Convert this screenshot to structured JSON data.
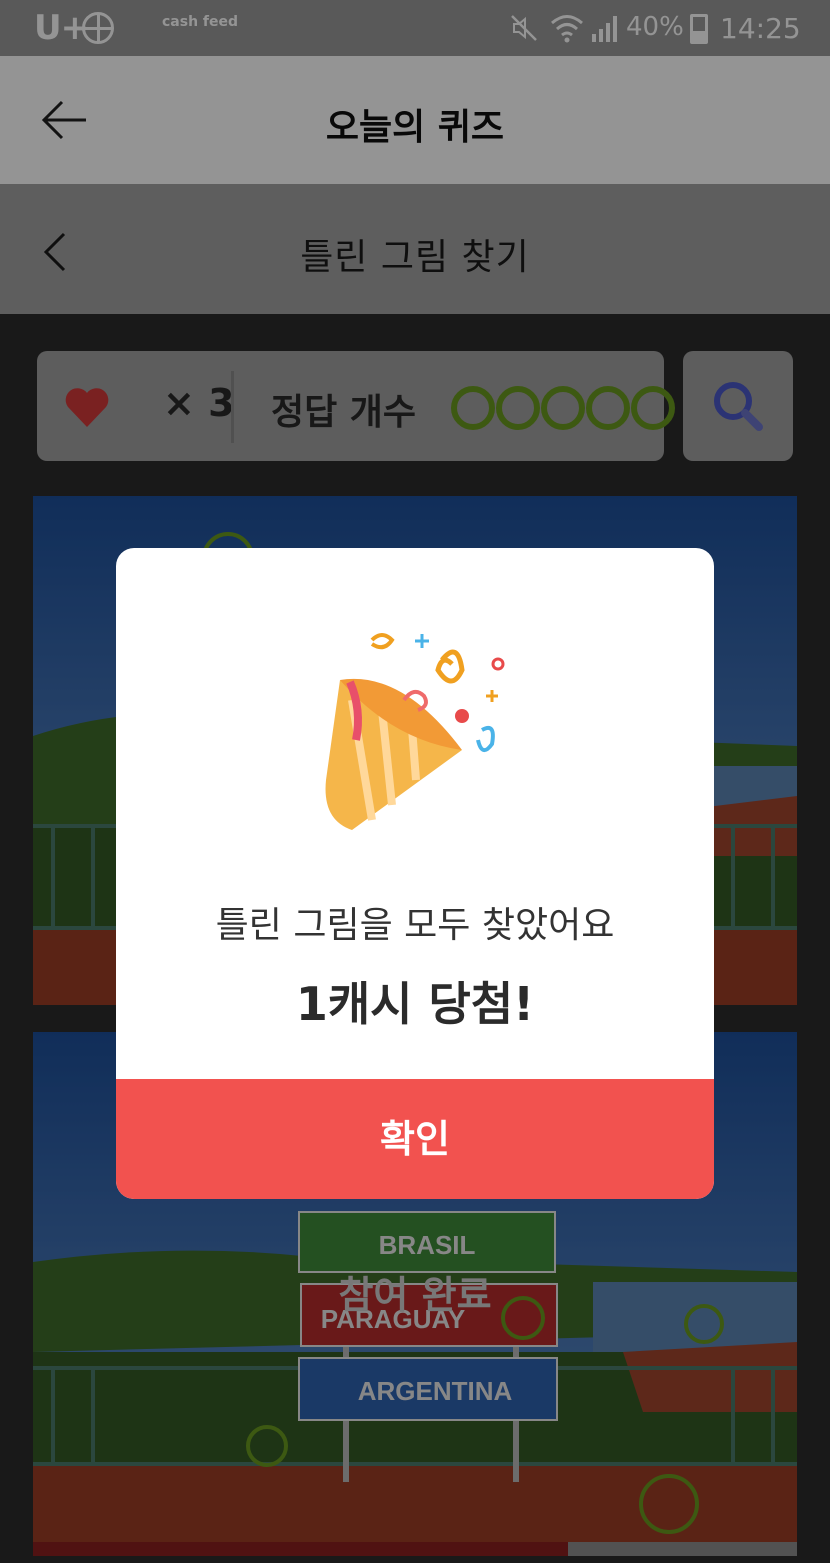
{
  "status_bar": {
    "carrier": "U+",
    "app_badge": "cash feed",
    "battery": "40%",
    "time": "14:25"
  },
  "app_bar": {
    "title": "오늘의 퀴즈"
  },
  "game": {
    "title": "틀린 그림 찾기",
    "lives": "× 3",
    "answer_label": "정답 개수",
    "answers_found": 5,
    "answers_total": 5,
    "photo_overlay_label": "참여 완료",
    "sign_brasil": "BRASIL",
    "sign_paraguay": "PARAGUAY",
    "sign_argentina": "ARGENTINA",
    "progress": 0.7
  },
  "modal": {
    "message": "틀린 그림을 모두 찾았어요",
    "prize": "1캐시 당첨!",
    "confirm_label": "확인"
  },
  "colors": {
    "accent_red": "#f2524f",
    "answer_green": "#6a9a1f",
    "heart_red": "#d23a3a",
    "search_blue": "#4a58c8"
  }
}
